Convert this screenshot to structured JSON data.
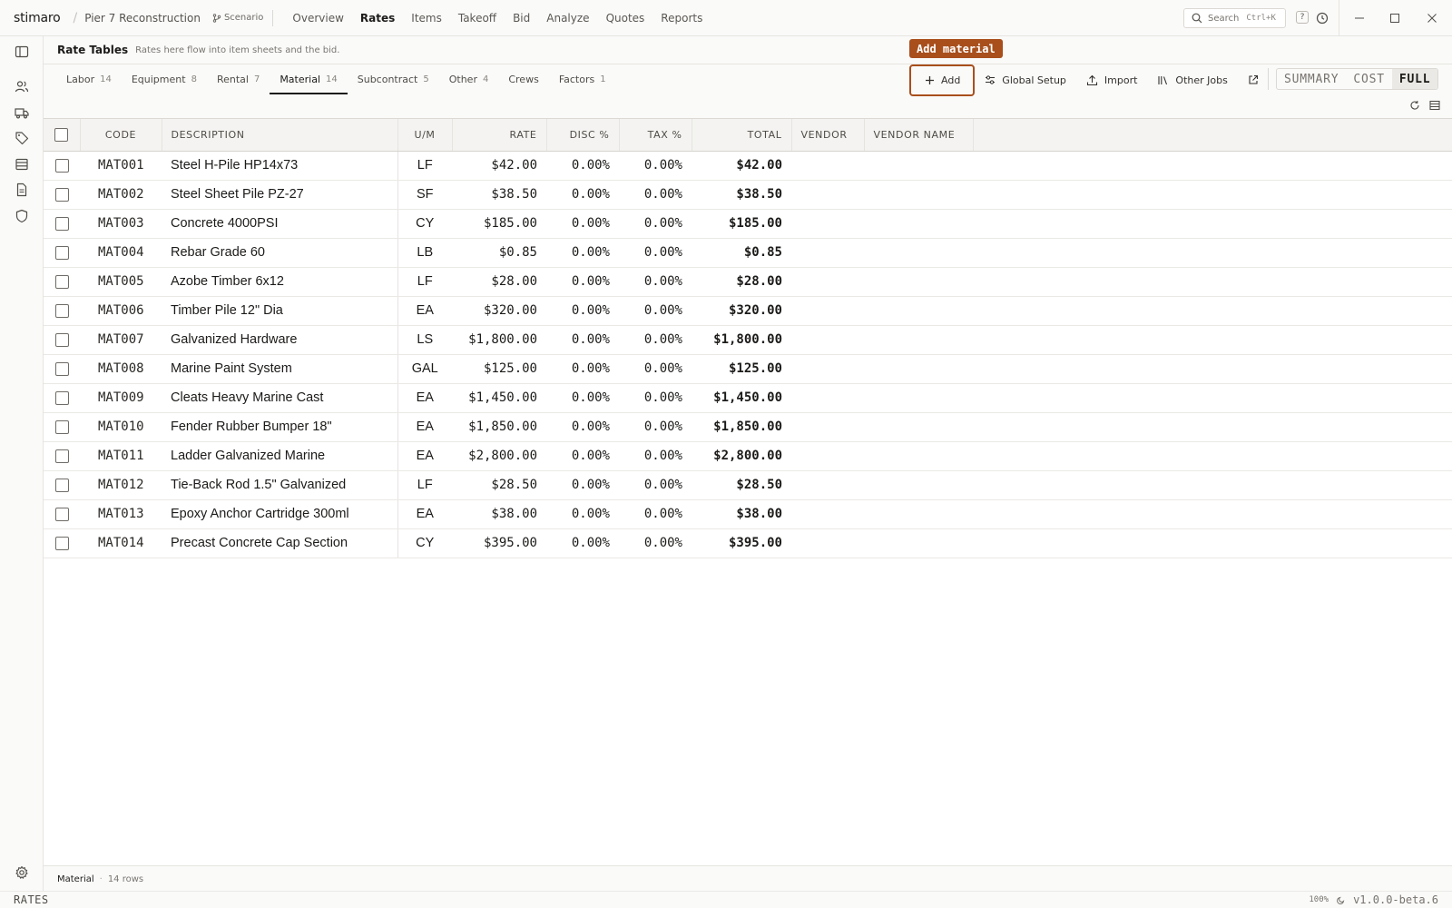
{
  "app": {
    "logo": "stimaro",
    "separator": "/",
    "project": "Pier 7 Reconstruction",
    "scenario_label": "Scenario",
    "nav": [
      "Overview",
      "Rates",
      "Items",
      "Takeoff",
      "Bid",
      "Analyze",
      "Quotes",
      "Reports"
    ],
    "active_nav": "Rates",
    "search_label": "Search",
    "search_shortcut": "Ctrl+K",
    "help_label": "?"
  },
  "header": {
    "title": "Rate Tables",
    "subtitle": "Rates here flow into item sheets and the bid."
  },
  "tooltip": "Add material",
  "tabs": [
    {
      "label": "Labor",
      "count": "14"
    },
    {
      "label": "Equipment",
      "count": "8"
    },
    {
      "label": "Rental",
      "count": "7"
    },
    {
      "label": "Material",
      "count": "14"
    },
    {
      "label": "Subcontract",
      "count": "5"
    },
    {
      "label": "Other",
      "count": "4"
    },
    {
      "label": "Crews",
      "count": ""
    },
    {
      "label": "Factors",
      "count": "1"
    }
  ],
  "active_tab": "Material",
  "toolbar": {
    "add_label": "Add",
    "global_setup_label": "Global Setup",
    "import_label": "Import",
    "other_jobs_label": "Other Jobs"
  },
  "view_modes": [
    "SUMMARY",
    "COST",
    "FULL"
  ],
  "active_view": "FULL",
  "table": {
    "headers": {
      "code": "CODE",
      "description": "DESCRIPTION",
      "um": "U/M",
      "rate": "RATE",
      "disc": "DISC %",
      "tax": "TAX %",
      "total": "TOTAL",
      "vendor": "VENDOR",
      "vendor_name": "VENDOR NAME"
    },
    "rows": [
      {
        "code": "MAT001",
        "description": "Steel H-Pile HP14x73",
        "um": "LF",
        "rate": "$42.00",
        "disc": "0.00%",
        "tax": "0.00%",
        "total": "$42.00"
      },
      {
        "code": "MAT002",
        "description": "Steel Sheet Pile PZ-27",
        "um": "SF",
        "rate": "$38.50",
        "disc": "0.00%",
        "tax": "0.00%",
        "total": "$38.50"
      },
      {
        "code": "MAT003",
        "description": "Concrete 4000PSI",
        "um": "CY",
        "rate": "$185.00",
        "disc": "0.00%",
        "tax": "0.00%",
        "total": "$185.00"
      },
      {
        "code": "MAT004",
        "description": "Rebar Grade 60",
        "um": "LB",
        "rate": "$0.85",
        "disc": "0.00%",
        "tax": "0.00%",
        "total": "$0.85"
      },
      {
        "code": "MAT005",
        "description": "Azobe Timber 6x12",
        "um": "LF",
        "rate": "$28.00",
        "disc": "0.00%",
        "tax": "0.00%",
        "total": "$28.00"
      },
      {
        "code": "MAT006",
        "description": "Timber Pile 12\" Dia",
        "um": "EA",
        "rate": "$320.00",
        "disc": "0.00%",
        "tax": "0.00%",
        "total": "$320.00"
      },
      {
        "code": "MAT007",
        "description": "Galvanized Hardware",
        "um": "LS",
        "rate": "$1,800.00",
        "disc": "0.00%",
        "tax": "0.00%",
        "total": "$1,800.00"
      },
      {
        "code": "MAT008",
        "description": "Marine Paint System",
        "um": "GAL",
        "rate": "$125.00",
        "disc": "0.00%",
        "tax": "0.00%",
        "total": "$125.00"
      },
      {
        "code": "MAT009",
        "description": "Cleats Heavy Marine Cast",
        "um": "EA",
        "rate": "$1,450.00",
        "disc": "0.00%",
        "tax": "0.00%",
        "total": "$1,450.00"
      },
      {
        "code": "MAT010",
        "description": "Fender Rubber Bumper 18\"",
        "um": "EA",
        "rate": "$1,850.00",
        "disc": "0.00%",
        "tax": "0.00%",
        "total": "$1,850.00"
      },
      {
        "code": "MAT011",
        "description": "Ladder Galvanized Marine",
        "um": "EA",
        "rate": "$2,800.00",
        "disc": "0.00%",
        "tax": "0.00%",
        "total": "$2,800.00"
      },
      {
        "code": "MAT012",
        "description": "Tie-Back Rod 1.5\" Galvanized",
        "um": "LF",
        "rate": "$28.50",
        "disc": "0.00%",
        "tax": "0.00%",
        "total": "$28.50"
      },
      {
        "code": "MAT013",
        "description": "Epoxy Anchor Cartridge 300ml",
        "um": "EA",
        "rate": "$38.00",
        "disc": "0.00%",
        "tax": "0.00%",
        "total": "$38.00"
      },
      {
        "code": "MAT014",
        "description": "Precast Concrete Cap Section",
        "um": "CY",
        "rate": "$395.00",
        "disc": "0.00%",
        "tax": "0.00%",
        "total": "$395.00"
      }
    ]
  },
  "footer": {
    "table_name": "Material",
    "dot": "·",
    "row_count": "14 rows"
  },
  "status": {
    "mode": "RATES",
    "zoom": "100%",
    "version": "v1.0.0-beta.6"
  },
  "colors": {
    "accent": "#a84f1c",
    "background": "#fafaf9"
  }
}
